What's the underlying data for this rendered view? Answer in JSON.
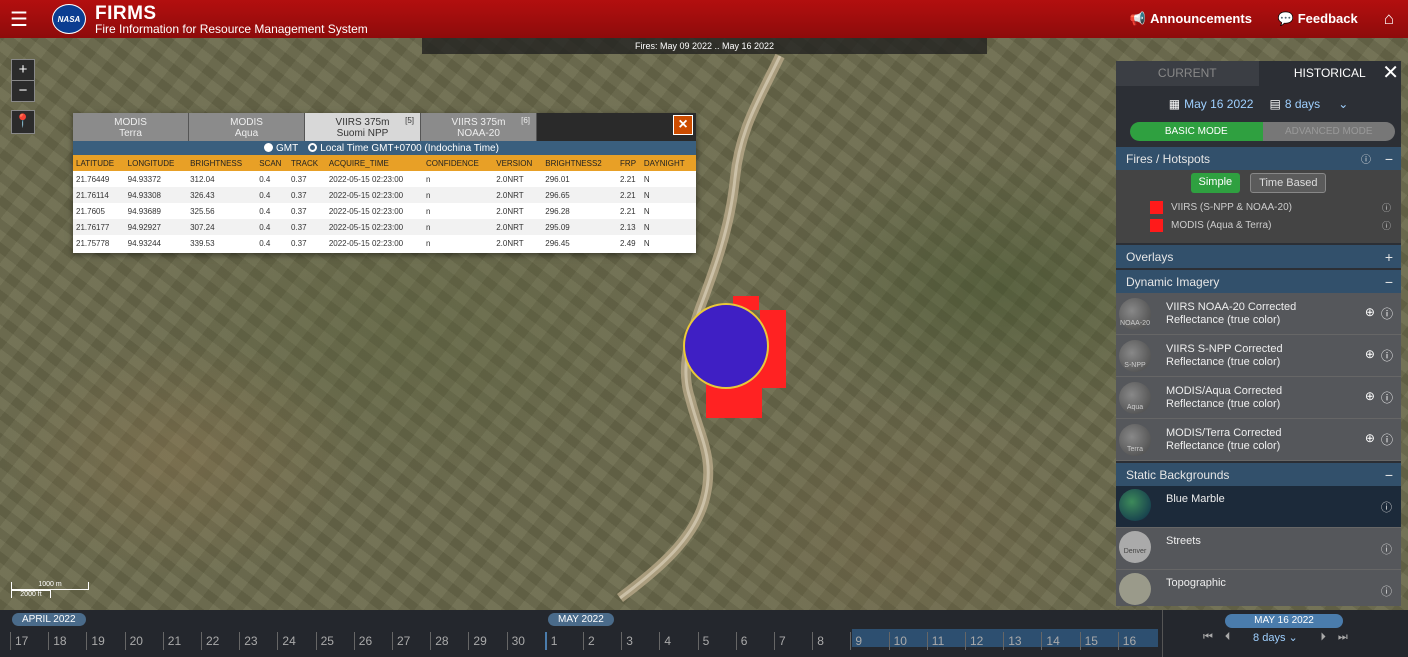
{
  "header": {
    "app_name": "FIRMS",
    "app_subtitle": "Fire Information for Resource Management System",
    "logo_text": "NASA",
    "announcements": "Announcements",
    "feedback": "Feedback"
  },
  "map": {
    "date_range": "Fires: May 09 2022 .. May 16 2022",
    "zoom_in": "+",
    "zoom_out": "−",
    "scale_metric": "1000 m",
    "scale_imperial": "2000 ft"
  },
  "popup": {
    "tabs": [
      {
        "label": "MODIS",
        "sub": "Terra",
        "count": ""
      },
      {
        "label": "MODIS",
        "sub": "Aqua",
        "count": ""
      },
      {
        "label": "VIIRS 375m",
        "sub": "Suomi NPP",
        "count": "[5]"
      },
      {
        "label": "VIIRS 375m",
        "sub": "NOAA-20",
        "count": "[6]"
      }
    ],
    "tz_gmt": "GMT",
    "tz_local": "Local Time GMT+0700 (Indochina Time)",
    "columns": [
      "LATITUDE",
      "LONGITUDE",
      "BRIGHTNESS",
      "SCAN",
      "TRACK",
      "ACQUIRE_TIME",
      "CONFIDENCE",
      "VERSION",
      "BRIGHTNESS2",
      "FRP",
      "DAYNIGHT"
    ],
    "rows": [
      [
        "21.76449",
        "94.93372",
        "312.04",
        "0.4",
        "0.37",
        "2022-05-15 02:23:00",
        "n",
        "2.0NRT",
        "296.01",
        "2.21",
        "N"
      ],
      [
        "21.76114",
        "94.93308",
        "326.43",
        "0.4",
        "0.37",
        "2022-05-15 02:23:00",
        "n",
        "2.0NRT",
        "296.65",
        "2.21",
        "N"
      ],
      [
        "21.7605",
        "94.93689",
        "325.56",
        "0.4",
        "0.37",
        "2022-05-15 02:23:00",
        "n",
        "2.0NRT",
        "296.28",
        "2.21",
        "N"
      ],
      [
        "21.76177",
        "94.92927",
        "307.24",
        "0.4",
        "0.37",
        "2022-05-15 02:23:00",
        "n",
        "2.0NRT",
        "295.09",
        "2.13",
        "N"
      ],
      [
        "21.75778",
        "94.93244",
        "339.53",
        "0.4",
        "0.37",
        "2022-05-15 02:23:00",
        "n",
        "2.0NRT",
        "296.45",
        "2.49",
        "N"
      ]
    ]
  },
  "panel": {
    "tab_current": "CURRENT",
    "tab_historical": "HISTORICAL",
    "date": "May 16 2022",
    "days": "8 days",
    "basic_mode": "BASIC MODE",
    "advanced_mode": "ADVANCED MODE",
    "fires_title": "Fires / Hotspots",
    "simple": "Simple",
    "time_based": "Time Based",
    "legend": [
      "VIIRS (S-NPP & NOAA-20)",
      "MODIS (Aqua & Terra)"
    ],
    "overlays_title": "Overlays",
    "dynamic_title": "Dynamic Imagery",
    "dynamic_items": [
      {
        "line1": "VIIRS NOAA-20 Corrected",
        "line2": "Reflectance (true color)",
        "thumb": "NOAA-20"
      },
      {
        "line1": "VIIRS S-NPP Corrected",
        "line2": "Reflectance (true color)",
        "thumb": "S-NPP"
      },
      {
        "line1": "MODIS/Aqua Corrected",
        "line2": "Reflectance (true color)",
        "thumb": "Aqua"
      },
      {
        "line1": "MODIS/Terra Corrected",
        "line2": "Reflectance (true color)",
        "thumb": "Terra"
      }
    ],
    "static_title": "Static Backgrounds",
    "static_items": [
      "Blue Marble",
      "Streets",
      "Topographic"
    ],
    "streets_thumb": "Denver"
  },
  "timeline": {
    "month1": "APRIL 2022",
    "month2": "MAY 2022",
    "days_april": [
      "17",
      "18",
      "19",
      "20",
      "21",
      "22",
      "23",
      "24",
      "25",
      "26",
      "27",
      "28",
      "29",
      "30"
    ],
    "days_may": [
      "1",
      "2",
      "3",
      "4",
      "5",
      "6",
      "7",
      "8",
      "9",
      "10",
      "11",
      "12",
      "13",
      "14",
      "15",
      "16"
    ],
    "current_date": "MAY 16 2022",
    "range": "8 days"
  }
}
